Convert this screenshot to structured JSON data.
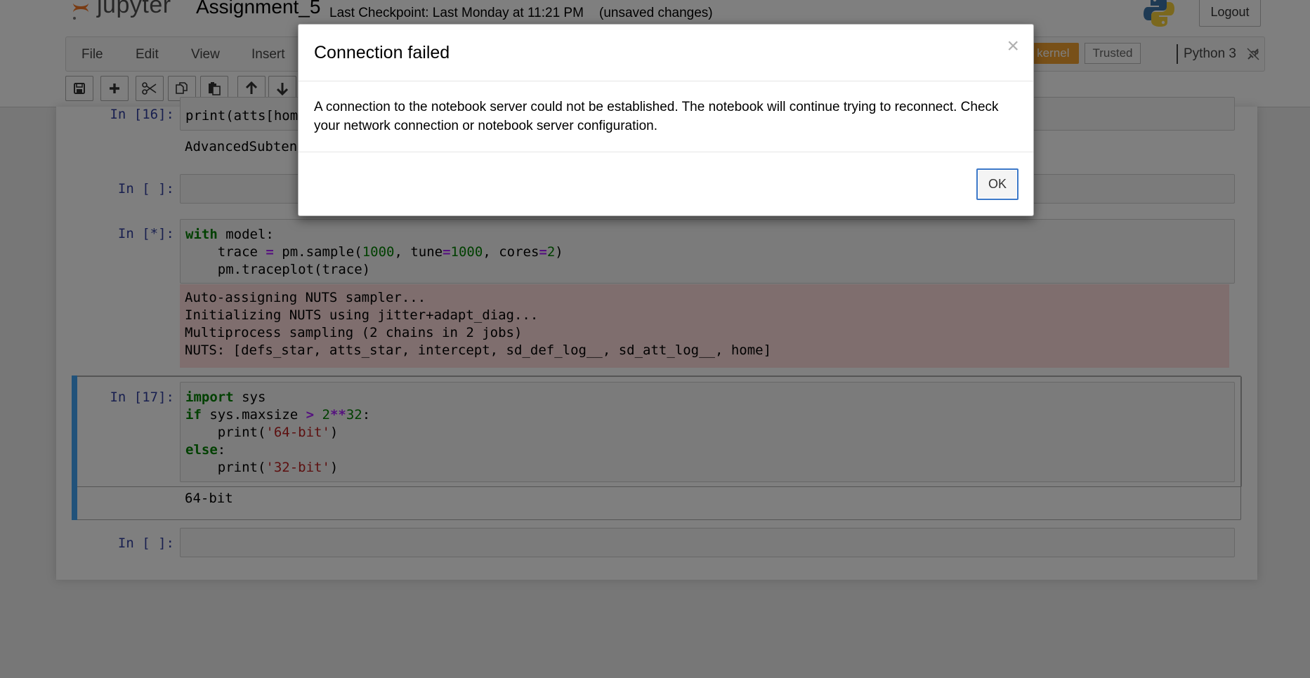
{
  "header": {
    "logo_text": "jupyter",
    "notebook_title": "Assignment_5",
    "checkpoint": "Last Checkpoint: Last Monday at 11:21 PM",
    "unsaved": "(unsaved changes)",
    "logout_label": "Logout"
  },
  "menu": {
    "items": [
      "File",
      "Edit",
      "View",
      "Insert"
    ]
  },
  "kernel": {
    "indicator": "n kernel",
    "trusted": "Trusted",
    "name": "Python 3"
  },
  "toolbar": {
    "icons": [
      "save-icon",
      "plus-icon",
      "cut-icon",
      "copy-icon",
      "paste-icon",
      "arrow-up-icon",
      "arrow-down-icon"
    ]
  },
  "cells": {
    "c16": {
      "prompt": "In [16]:",
      "code": "print(atts[hom",
      "output": "AdvancedSubten"
    },
    "empty1": {
      "prompt": "In [ ]:"
    },
    "running": {
      "prompt": "In [*]:",
      "l1_kw": "with",
      "l1_rest": " model:",
      "l2_a": "    trace ",
      "l2_eq": "=",
      "l2_b": " pm.sample(",
      "l2_n1": "1000",
      "l2_c": ", tune",
      "l2_eq2": "=",
      "l2_n2": "1000",
      "l2_d": ", cores",
      "l2_eq3": "=",
      "l2_n3": "2",
      "l2_e": ")",
      "l3": "    pm.traceplot(trace)",
      "stderr": [
        "Auto-assigning NUTS sampler...",
        "Initializing NUTS using jitter+adapt_diag...",
        "Multiprocess sampling (2 chains in 2 jobs)",
        "NUTS: [defs_star, atts_star, intercept, sd_def_log__, sd_att_log__, home]"
      ]
    },
    "c17": {
      "prompt": "In [17]:",
      "l1_kw": "import",
      "l1_rest": " sys",
      "l2_kw": "if",
      "l2_a": " sys.maxsize ",
      "l2_op": ">",
      "l2_sp": " ",
      "l2_n1": "2",
      "l2_op2": "**",
      "l2_n2": "32",
      "l2_end": ":",
      "l3_a": "    print(",
      "l3_str": "'64-bit'",
      "l3_b": ")",
      "l4_kw": "else",
      "l4_end": ":",
      "l5_a": "    print(",
      "l5_str": "'32-bit'",
      "l5_b": ")",
      "output": "64-bit"
    },
    "empty2": {
      "prompt": "In [ ]:"
    }
  },
  "modal": {
    "title": "Connection failed",
    "close": "×",
    "body": "A connection to the notebook server could not be established. The notebook will continue trying to reconnect. Check your network connection or notebook server configuration.",
    "ok_label": "OK"
  },
  "colors": {
    "accent": "#42a5f5",
    "kernel_busy": "#f0a030",
    "prompt": "#303f9f",
    "stderr_bg": "#ffdddd"
  }
}
